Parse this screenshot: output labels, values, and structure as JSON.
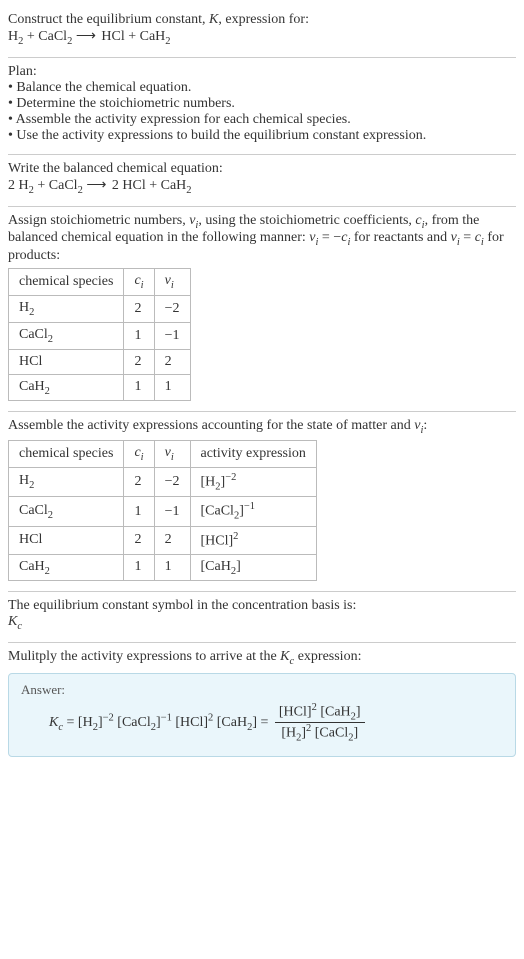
{
  "intro": {
    "line1": "Construct the equilibrium constant, K, expression for:",
    "equation": "H₂ + CaCl₂ ⟶ HCl + CaH₂"
  },
  "plan": {
    "label": "Plan:",
    "b1": "• Balance the chemical equation.",
    "b2": "• Determine the stoichiometric numbers.",
    "b3": "• Assemble the activity expression for each chemical species.",
    "b4": "• Use the activity expressions to build the equilibrium constant expression."
  },
  "balanced": {
    "text": "Write the balanced chemical equation:",
    "equation": "2 H₂ + CaCl₂ ⟶ 2 HCl + CaH₂"
  },
  "stoich": {
    "text": "Assign stoichiometric numbers, νᵢ, using the stoichiometric coefficients, cᵢ, from the balanced chemical equation in the following manner: νᵢ = −cᵢ for reactants and νᵢ = cᵢ for products:",
    "headers": {
      "sp": "chemical species",
      "ci": "cᵢ",
      "vi": "νᵢ"
    },
    "rows": [
      {
        "sp": "H₂",
        "ci": "2",
        "vi": "−2"
      },
      {
        "sp": "CaCl₂",
        "ci": "1",
        "vi": "−1"
      },
      {
        "sp": "HCl",
        "ci": "2",
        "vi": "2"
      },
      {
        "sp": "CaH₂",
        "ci": "1",
        "vi": "1"
      }
    ]
  },
  "activity": {
    "text": "Assemble the activity expressions accounting for the state of matter and νᵢ:",
    "headers": {
      "sp": "chemical species",
      "ci": "cᵢ",
      "vi": "νᵢ",
      "ae": "activity expression"
    },
    "rows": [
      {
        "sp": "H₂",
        "ci": "2",
        "vi": "−2",
        "ae": "[H₂]⁻²"
      },
      {
        "sp": "CaCl₂",
        "ci": "1",
        "vi": "−1",
        "ae": "[CaCl₂]⁻¹"
      },
      {
        "sp": "HCl",
        "ci": "2",
        "vi": "2",
        "ae": "[HCl]²"
      },
      {
        "sp": "CaH₂",
        "ci": "1",
        "vi": "1",
        "ae": "[CaH₂]"
      }
    ]
  },
  "symbol": {
    "text": "The equilibrium constant symbol in the concentration basis is:",
    "kc": "K_c"
  },
  "multiply": {
    "text": "Mulitply the activity expressions to arrive at the K_c expression:"
  },
  "answer": {
    "label": "Answer:",
    "lhs": "K_c = [H₂]⁻² [CaCl₂]⁻¹ [HCl]² [CaH₂] =",
    "num": "[HCl]² [CaH₂]",
    "den": "[H₂]² [CaCl₂]"
  },
  "chart_data": {
    "type": "table",
    "title": "Stoichiometric numbers and activity expressions",
    "series": [
      {
        "name": "cᵢ",
        "categories": [
          "H₂",
          "CaCl₂",
          "HCl",
          "CaH₂"
        ],
        "values": [
          2,
          1,
          2,
          1
        ]
      },
      {
        "name": "νᵢ",
        "categories": [
          "H₂",
          "CaCl₂",
          "HCl",
          "CaH₂"
        ],
        "values": [
          -2,
          -1,
          2,
          1
        ]
      }
    ],
    "activity_expressions": {
      "H₂": "[H₂]^-2",
      "CaCl₂": "[CaCl₂]^-1",
      "HCl": "[HCl]^2",
      "CaH₂": "[CaH₂]"
    }
  }
}
